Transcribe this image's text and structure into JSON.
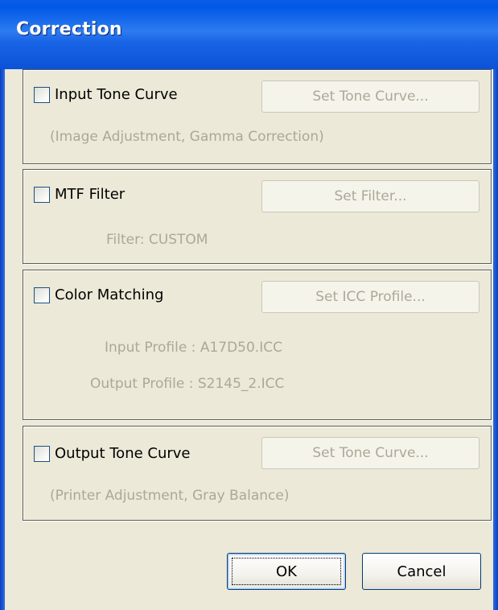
{
  "window": {
    "title": "Correction"
  },
  "input_tone_curve": {
    "checkbox_label": "Input Tone Curve",
    "checked": false,
    "button_label": "Set Tone Curve...",
    "description": "(Image Adjustment, Gamma Correction)"
  },
  "mtf_filter": {
    "checkbox_label": "MTF Filter",
    "checked": false,
    "button_label": "Set Filter...",
    "description": "Filter: CUSTOM"
  },
  "color_matching": {
    "checkbox_label": "Color Matching",
    "checked": false,
    "button_label": "Set ICC Profile...",
    "input_profile": "Input Profile :  A17D50.ICC",
    "output_profile": "Output Profile :  S2145_2.ICC"
  },
  "output_tone_curve": {
    "checkbox_label": "Output Tone Curve",
    "checked": false,
    "button_label": "Set Tone Curve...",
    "description": "(Printer Adjustment, Gray Balance)"
  },
  "buttons": {
    "ok": "OK",
    "cancel": "Cancel"
  },
  "colors": {
    "titlebar": "#0058E6",
    "dialog_bg": "#ECE9D8",
    "disabled_text": "#ACA899"
  }
}
